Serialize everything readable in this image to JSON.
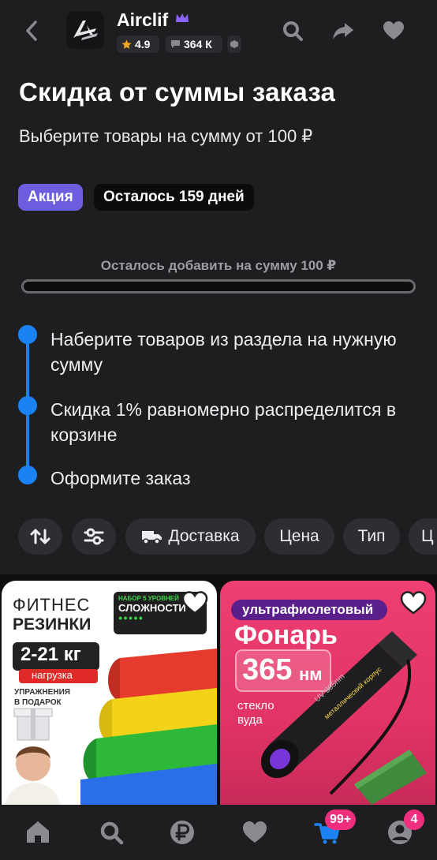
{
  "header": {
    "store_name": "Airclif",
    "rating": "4.9",
    "reviews": "364 К"
  },
  "promo": {
    "title": "Скидка от суммы заказа",
    "subtitle": "Выберите товары на сумму от 100 ₽",
    "badge": "Акция",
    "days_left": "Осталось 159 дней",
    "progress_label": "Осталось добавить на сумму 100 ₽",
    "progress": 0
  },
  "steps": [
    "Наберите товаров из раздела на нужную сумму",
    "Скидка 1% равномерно распределится в корзине",
    "Оформите заказ"
  ],
  "filters": {
    "delivery": "Доставка",
    "price": "Цена",
    "type": "Тип",
    "color_cut": "Ц"
  },
  "product1": {
    "t1": "ФИТНЕС",
    "t2": "РЕЗИНКИ",
    "badge1": "НАБОР 5 УРОВНЕЙ",
    "badge2": "СЛОЖНОСТИ",
    "weight": "2-21 кг",
    "load": "нагрузка",
    "gift1": "УПРАЖНЕНИЯ",
    "gift2": "В ПОДАРОК"
  },
  "product2": {
    "t1": "ультрафиолетовый",
    "t2": "Фонарь",
    "nm": "365",
    "nm_unit": "нм",
    "glass1": "стекло",
    "glass2": "вуда",
    "body": "металлический корпус",
    "body_short": "UV 365nm"
  },
  "bottom_nav": {
    "cart_badge": "99+",
    "profile_badge": "4"
  },
  "colors": {
    "accent": "#1a82f2",
    "promo_badge": "#6d5ddf",
    "notification": "#ef2e7d"
  }
}
